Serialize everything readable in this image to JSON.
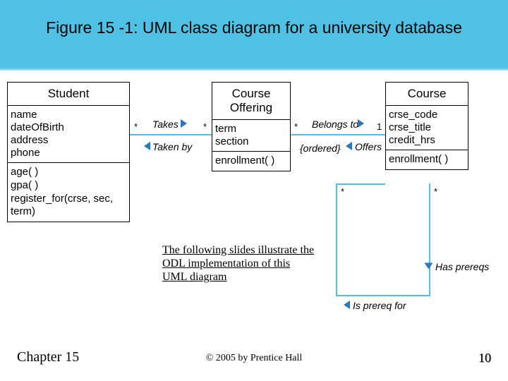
{
  "title": "Figure 15 -1: UML class diagram for a university database",
  "student": {
    "name": "Student",
    "attrs": [
      "name",
      "dateOfBirth",
      "address",
      "phone"
    ],
    "ops": [
      "age( )",
      "gpa( )",
      "register_for(crse, sec, term)"
    ]
  },
  "offering": {
    "name": "Course\nOffering",
    "attrs": [
      "term",
      "section"
    ],
    "ops": [
      "enrollment( )"
    ]
  },
  "course": {
    "name": "Course",
    "attrs": [
      "crse_code",
      "crse_title",
      "credit_hrs"
    ],
    "ops": [
      "enrollment( )"
    ]
  },
  "assoc": {
    "takes": "Takes",
    "takenby": "Taken by",
    "belongsto": "Belongs to",
    "offers": "Offers",
    "ordered": "{ordered}",
    "hasprereqs": "Has prereqs",
    "isprereqfor": "Is prereq for"
  },
  "mult": {
    "star": "*",
    "one": "1"
  },
  "note": "The following slides illustrate the\nODL implementation of this\nUML diagram",
  "chapter": "Chapter 15",
  "copyright": "© 2005 by Prentice Hall",
  "pagenum": "10"
}
